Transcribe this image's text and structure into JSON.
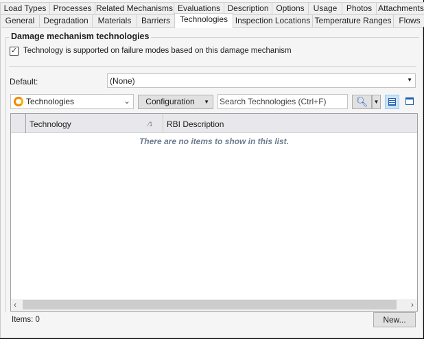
{
  "tabs_row1": [
    "Load Types",
    "Processes",
    "Related Mechanisms",
    "Evaluations",
    "Description",
    "Options",
    "Usage",
    "Photos",
    "Attachments"
  ],
  "tabs_row2": [
    "General",
    "Degradation",
    "Materials",
    "Barriers",
    "Technologies",
    "Inspection Locations",
    "Temperature Ranges",
    "Flows"
  ],
  "selected_tab": "Technologies",
  "group_title": "Damage mechanism technologies",
  "checkbox": {
    "label": "Technology is supported on failure modes based on this damage mechanism",
    "checked": true
  },
  "default": {
    "label": "Default:",
    "value": "(None)"
  },
  "toolbar": {
    "view_combo": "Technologies",
    "configuration": "Configuration",
    "search_placeholder": "Search Technologies  (Ctrl+F)"
  },
  "grid": {
    "columns": [
      "Technology",
      "RBI Description"
    ],
    "sort_indicator": "1",
    "empty_message": "There are no items to show in this list."
  },
  "footer": {
    "items": "Items: 0",
    "new_button": "New..."
  }
}
